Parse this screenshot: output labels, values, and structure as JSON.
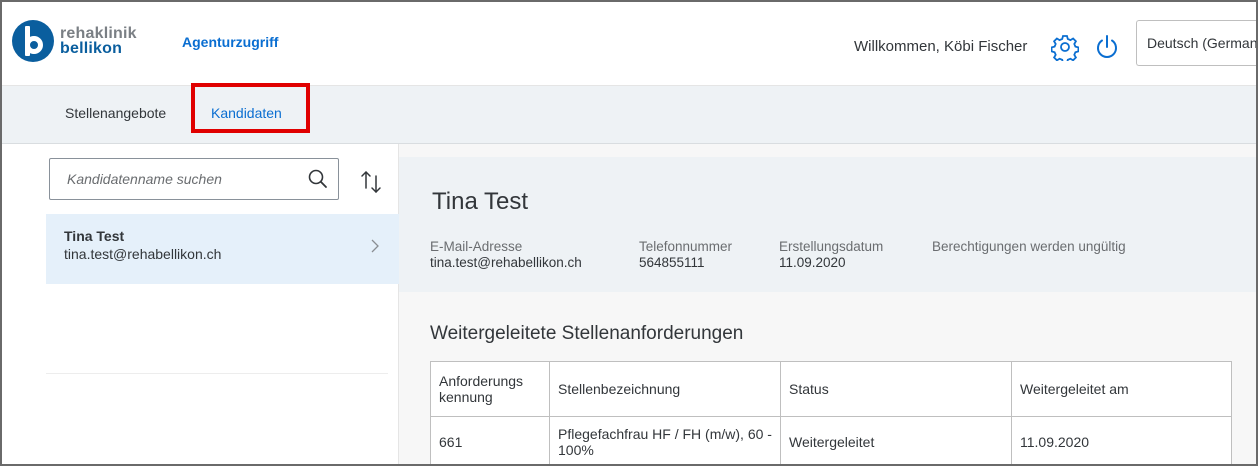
{
  "header": {
    "logo_line1": "rehaklinik",
    "logo_line2": "bellikon",
    "app_title": "Agenturzugriff",
    "welcome_text": "Willkommen, Köbi Fischer",
    "language": "Deutsch (German)",
    "settings_icon": "gear-icon",
    "logout_icon": "power-icon"
  },
  "tabs": [
    {
      "label": "Stellenangebote"
    },
    {
      "label": "Kandidaten",
      "selected": true
    }
  ],
  "search": {
    "placeholder": "Kandidatenname suchen"
  },
  "candidates": [
    {
      "name": "Tina Test",
      "email": "tina.test@rehabellikon.ch"
    }
  ],
  "detail": {
    "title": "Tina Test",
    "attributes": [
      {
        "label": "E-Mail-Adresse",
        "value": "tina.test@rehabellikon.ch"
      },
      {
        "label": "Telefonnummer",
        "value": "564855111"
      },
      {
        "label": "Erstellungsdatum",
        "value": "11.09.2020"
      },
      {
        "label": "Berechtigungen werden ungültig",
        "value": ""
      }
    ],
    "section_title": "Weitergeleitete Stellenanforderungen",
    "table": {
      "headers": [
        "Anforderungs kennung",
        "Stellenbezeichnung",
        "Status",
        "Weitergeleitet am"
      ],
      "rows": [
        [
          "661",
          "Pflegefachfrau HF / FH (m/w), 60 - 100%",
          "Weitergeleitet",
          "11.09.2020"
        ]
      ]
    }
  },
  "colors": {
    "brand_blue": "#0a5e9e",
    "link_blue": "#0a6ed1",
    "highlight_red": "#e00000",
    "selected_row": "#e5f0fa"
  }
}
